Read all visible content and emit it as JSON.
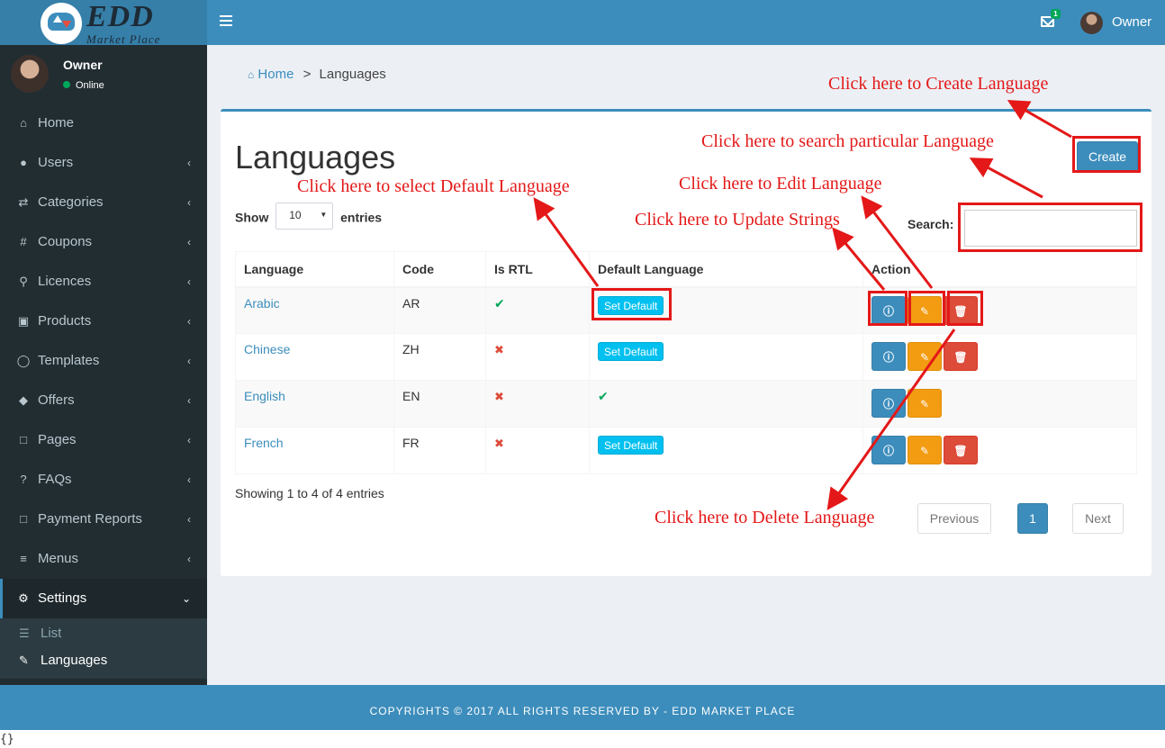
{
  "brand": {
    "title": "EDD",
    "subtitle": "Market Place"
  },
  "topbar": {
    "mail_count": "1",
    "user": "Owner"
  },
  "sidebar": {
    "user_name": "Owner",
    "status": "Online",
    "items": [
      {
        "label": "Home",
        "icon": "home-icon"
      },
      {
        "label": "Users",
        "icon": "users-icon"
      },
      {
        "label": "Categories",
        "icon": "random-icon"
      },
      {
        "label": "Coupons",
        "icon": "hash-icon"
      },
      {
        "label": "Licences",
        "icon": "key-icon"
      },
      {
        "label": "Products",
        "icon": "briefcase-icon"
      },
      {
        "label": "Templates",
        "icon": "comment-icon"
      },
      {
        "label": "Offers",
        "icon": "tags-icon"
      },
      {
        "label": "Pages",
        "icon": "file-icon"
      },
      {
        "label": "FAQs",
        "icon": "question-icon"
      },
      {
        "label": "Payment Reports",
        "icon": "file-icon"
      },
      {
        "label": "Menus",
        "icon": "bars-icon"
      },
      {
        "label": "Settings",
        "icon": "gear-icon"
      }
    ],
    "submenu": [
      {
        "label": "List",
        "icon": "list-icon"
      },
      {
        "label": "Languages",
        "icon": "language-icon"
      }
    ]
  },
  "breadcrumb": {
    "home": "Home",
    "separator": ">",
    "current": "Languages"
  },
  "main": {
    "title": "Languages",
    "create_label": "Create",
    "show_label": "Show",
    "entries_label": "entries",
    "page_size": "10",
    "search_label": "Search:",
    "search_value": "",
    "columns": [
      "Language",
      "Code",
      "Is RTL",
      "Default Language",
      "Action"
    ],
    "rows": [
      {
        "language": "Arabic",
        "code": "AR",
        "is_rtl": true,
        "is_default": false
      },
      {
        "language": "Chinese",
        "code": "ZH",
        "is_rtl": false,
        "is_default": false
      },
      {
        "language": "English",
        "code": "EN",
        "is_rtl": false,
        "is_default": true
      },
      {
        "language": "French",
        "code": "FR",
        "is_rtl": false,
        "is_default": false
      }
    ],
    "set_default_label": "Set Default",
    "showing_text": "Showing 1 to 4 of 4 entries",
    "pagination": {
      "previous": "Previous",
      "page": "1",
      "next": "Next"
    }
  },
  "annotations": {
    "create": "Click here to Create Language",
    "search": "Click here to search particular Language",
    "default": "Click here to select Default Language",
    "edit": "Click here to Edit Language",
    "update": "Click here to Update Strings",
    "delete": "Click here to Delete Language",
    "color": "#e41818"
  },
  "footer": {
    "text": "COPYRIGHTS © 2017 ALL RIGHTS RESERVED BY - EDD MARKET PLACE"
  },
  "trailing_text": "{}",
  "colors": {
    "primary": "#3c8dbc",
    "sidebar": "#222d32",
    "info": "#00c0ef",
    "warning": "#f39c12",
    "danger": "#dd4b39",
    "success": "#00a65a"
  }
}
